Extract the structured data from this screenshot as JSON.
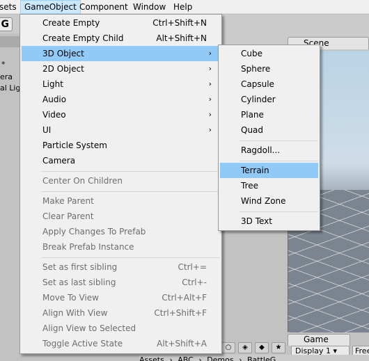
{
  "menubar": {
    "items": [
      {
        "label": "sets"
      },
      {
        "label": "GameObject"
      },
      {
        "label": "Component"
      },
      {
        "label": "Window"
      },
      {
        "label": "Help"
      }
    ]
  },
  "toolbar": {
    "tool_glyph": "G"
  },
  "hierarchy": {
    "tab_text": "*",
    "rows": [
      "era",
      "al Ligh"
    ]
  },
  "scene": {
    "tab_label": "Scene"
  },
  "game": {
    "tab_label": "Game",
    "display": "Display 1",
    "free_label": "Free"
  },
  "project": {
    "breadcrumb": [
      "Assets",
      "ABC",
      "Demos",
      "BattleG"
    ]
  },
  "gameobject_menu": {
    "items": [
      {
        "label": "Create Empty",
        "shortcut": "Ctrl+Shift+N"
      },
      {
        "label": "Create Empty Child",
        "shortcut": "Alt+Shift+N"
      },
      {
        "label": "3D Object",
        "arrow": "›"
      },
      {
        "label": "2D Object",
        "arrow": "›"
      },
      {
        "label": "Light",
        "arrow": "›"
      },
      {
        "label": "Audio",
        "arrow": "›"
      },
      {
        "label": "Video",
        "arrow": "›"
      },
      {
        "label": "UI",
        "arrow": "›"
      },
      {
        "label": "Particle System"
      },
      {
        "label": "Camera"
      },
      {
        "label": "Center On Children"
      },
      {
        "label": "Make Parent"
      },
      {
        "label": "Clear Parent"
      },
      {
        "label": "Apply Changes To Prefab"
      },
      {
        "label": "Break Prefab Instance"
      },
      {
        "label": "Set as first sibling",
        "shortcut": "Ctrl+="
      },
      {
        "label": "Set as last sibling",
        "shortcut": "Ctrl+-"
      },
      {
        "label": "Move To View",
        "shortcut": "Ctrl+Alt+F"
      },
      {
        "label": "Align With View",
        "shortcut": "Ctrl+Shift+F"
      },
      {
        "label": "Align View to Selected"
      },
      {
        "label": "Toggle Active State",
        "shortcut": "Alt+Shift+A"
      }
    ]
  },
  "object3d_menu": {
    "items": [
      {
        "label": "Cube"
      },
      {
        "label": "Sphere"
      },
      {
        "label": "Capsule"
      },
      {
        "label": "Cylinder"
      },
      {
        "label": "Plane"
      },
      {
        "label": "Quad"
      },
      {
        "label": "Ragdoll..."
      },
      {
        "label": "Terrain"
      },
      {
        "label": "Tree"
      },
      {
        "label": "Wind Zone"
      },
      {
        "label": "3D Text"
      }
    ]
  },
  "colors": {
    "menu_bg": "#f0f0f0",
    "highlight": "#91c9f7",
    "menubar_active": "#cce8ff",
    "disabled_text": "#6d6d6d"
  }
}
